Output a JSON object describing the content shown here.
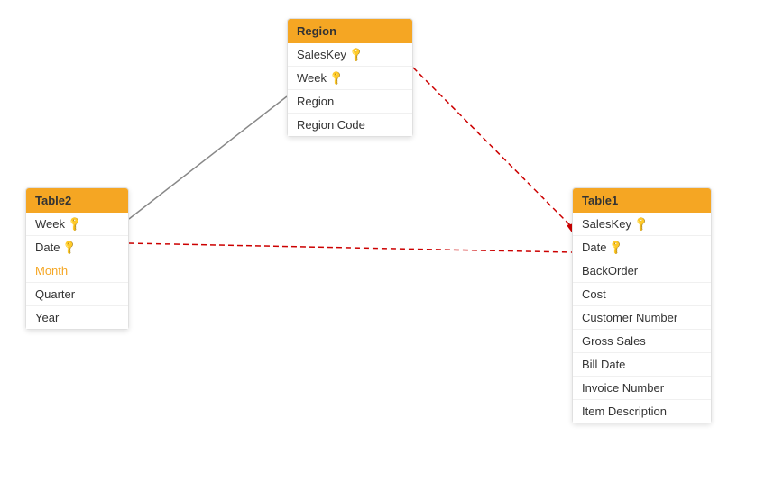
{
  "tables": {
    "table2": {
      "title": "Table2",
      "fields": [
        {
          "name": "Week",
          "key": true,
          "highlighted": false
        },
        {
          "name": "Date",
          "key": true,
          "highlighted": false
        },
        {
          "name": "Month",
          "key": false,
          "highlighted": true
        },
        {
          "name": "Quarter",
          "key": false,
          "highlighted": false
        },
        {
          "name": "Year",
          "key": false,
          "highlighted": false
        }
      ]
    },
    "region": {
      "title": "Region",
      "fields": [
        {
          "name": "SalesKey",
          "key": true,
          "highlighted": false
        },
        {
          "name": "Week",
          "key": true,
          "highlighted": false
        },
        {
          "name": "Region",
          "key": false,
          "highlighted": false
        },
        {
          "name": "Region Code",
          "key": false,
          "highlighted": false
        }
      ]
    },
    "table1": {
      "title": "Table1",
      "fields": [
        {
          "name": "SalesKey",
          "key": true,
          "highlighted": false
        },
        {
          "name": "Date",
          "key": true,
          "highlighted": false
        },
        {
          "name": "BackOrder",
          "key": false,
          "highlighted": false
        },
        {
          "name": "Cost",
          "key": false,
          "highlighted": false
        },
        {
          "name": "Customer Number",
          "key": false,
          "highlighted": false
        },
        {
          "name": "Gross Sales",
          "key": false,
          "highlighted": false
        },
        {
          "name": "Bill Date",
          "key": false,
          "highlighted": false
        },
        {
          "name": "Invoice Number",
          "key": false,
          "highlighted": false
        },
        {
          "name": "Item Description",
          "key": false,
          "highlighted": false
        }
      ]
    }
  }
}
